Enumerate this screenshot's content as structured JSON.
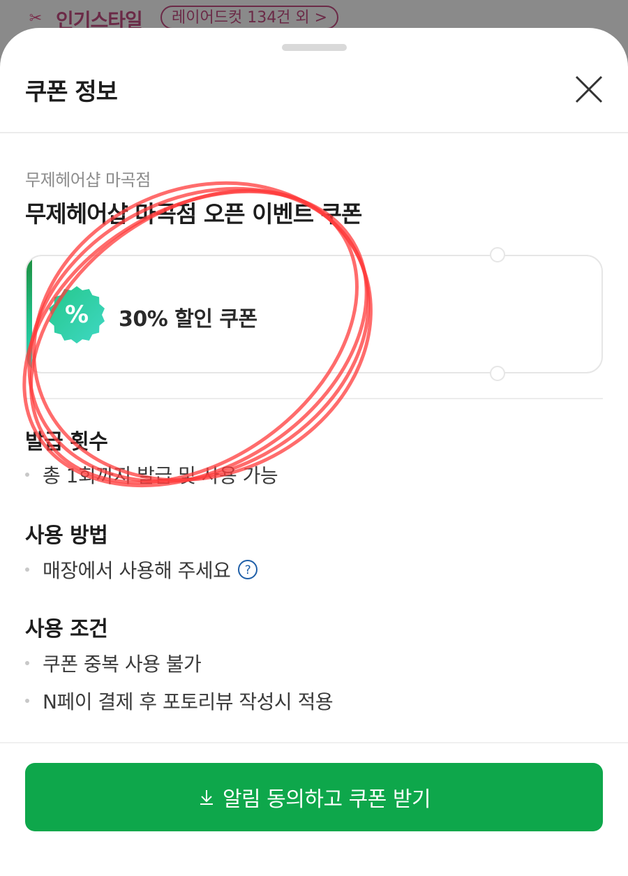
{
  "behind": {
    "title": "인기스타일",
    "pill": "레이어드컷 134건 외 >",
    "icon": "scissor-icon"
  },
  "sheet": {
    "title": "쿠폰 정보",
    "close_icon": "close-icon"
  },
  "coupon": {
    "shop_name": "무제헤어샵 마곡점",
    "title": "무제헤어샵 마곡점 오픈 이벤트 쿠폰",
    "label": "30% 할인 쿠폰",
    "badge_text": "%",
    "badge_color": "#2fcf9a",
    "stripe_color": "#20c08a"
  },
  "sections": [
    {
      "title": "발급 횟수",
      "items": [
        "총 1회까지 발급 및 사용 가능"
      ]
    },
    {
      "title": "사용 방법",
      "items": [
        "매장에서 사용해 주세요"
      ]
    },
    {
      "title": "사용 조건",
      "items": [
        "쿠폰 중복 사용 불가",
        "N페이 결제 후 포토리뷰 작성시 적용"
      ]
    }
  ],
  "cta": {
    "label": "알림 동의하고 쿠폰 받기",
    "color": "#0ea74b",
    "icon": "download-icon"
  }
}
